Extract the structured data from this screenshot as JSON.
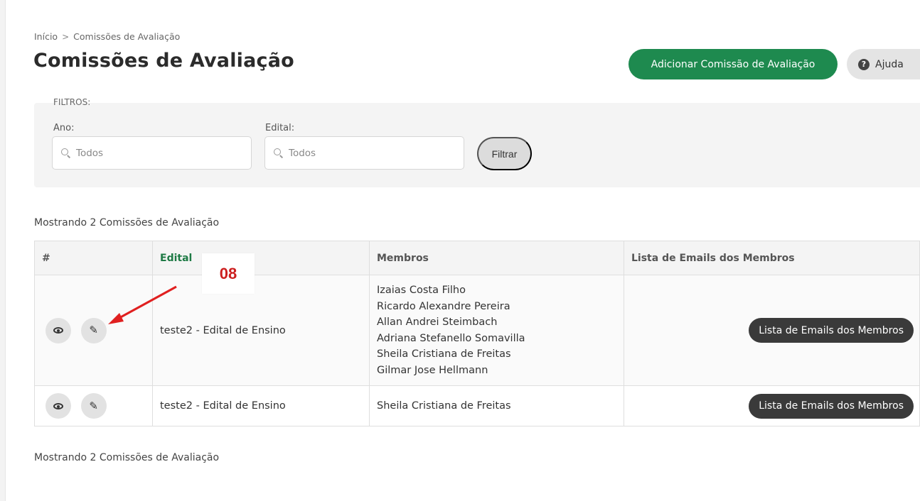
{
  "breadcrumb": {
    "home": "Início",
    "separator": ">",
    "current": "Comissões de Avaliação"
  },
  "page": {
    "title": "Comissões de Avaliação"
  },
  "header_actions": {
    "add_label": "Adicionar Comissão de Avaliação",
    "help_label": "Ajuda"
  },
  "filters": {
    "title": "FILTROS:",
    "ano": {
      "label": "Ano:",
      "placeholder": "Todos"
    },
    "edital": {
      "label": "Edital:",
      "placeholder": "Todos"
    },
    "button": "Filtrar"
  },
  "summary": {
    "top": "Mostrando 2 Comissões de Avaliação",
    "bottom": "Mostrando 2 Comissões de Avaliação"
  },
  "table": {
    "columns": [
      "#",
      "Edital",
      "Membros",
      "Lista de Emails dos Membros"
    ],
    "rows": [
      {
        "edital": "teste2 - Edital de Ensino",
        "members": [
          "Izaias Costa Filho",
          "Ricardo Alexandre Pereira",
          "Allan Andrei Steimbach",
          "Adriana Stefanello Somavilla",
          "Sheila Cristiana de Freitas",
          "Gilmar Jose Hellmann"
        ],
        "emails_button": "Lista de Emails dos Membros"
      },
      {
        "edital": "teste2 - Edital de Ensino",
        "members": [
          "Sheila Cristiana de Freitas"
        ],
        "emails_button": "Lista de Emails dos Membros"
      }
    ]
  },
  "annotation": {
    "label": "08",
    "color": "#cc1f1f"
  },
  "colors": {
    "accent_green": "#1e8a4f",
    "dark_button": "#3a3a3a"
  },
  "icons": {
    "view": "eye-icon",
    "edit": "pencil-icon",
    "help": "question-circle-icon",
    "search": "search-icon"
  }
}
